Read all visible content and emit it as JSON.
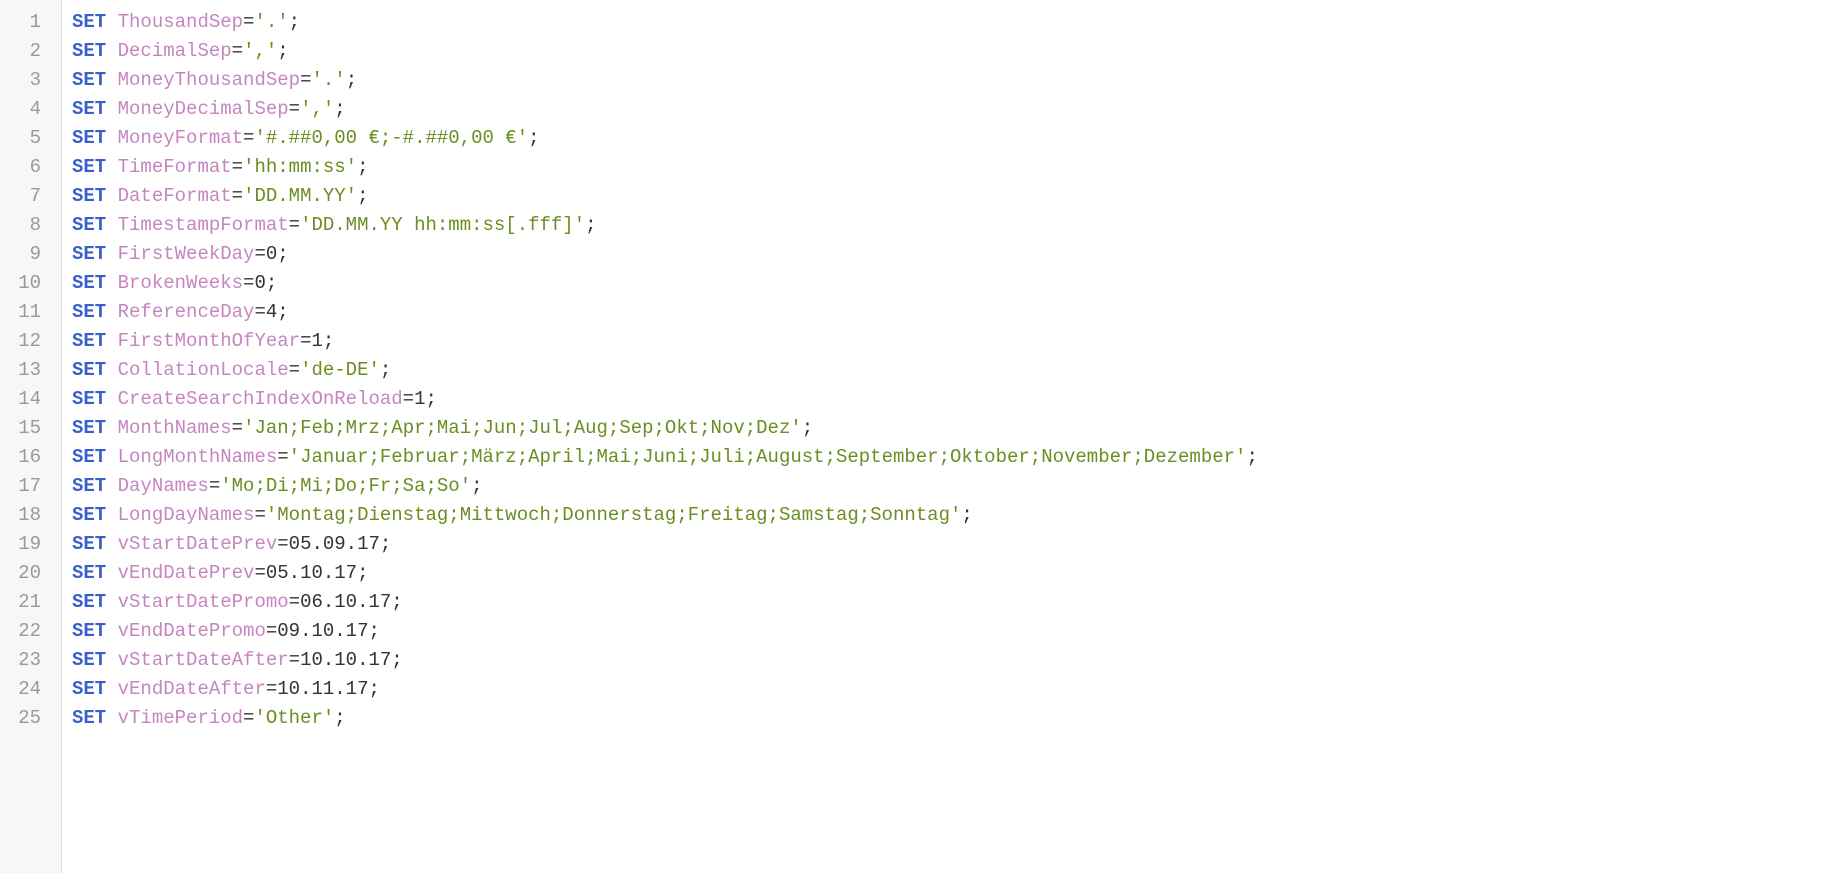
{
  "lines": [
    {
      "ln": "1",
      "kw": "SET",
      "var": "ThousandSep",
      "value": "'.'",
      "valueType": "str"
    },
    {
      "ln": "2",
      "kw": "SET",
      "var": "DecimalSep",
      "value": "','",
      "valueType": "str"
    },
    {
      "ln": "3",
      "kw": "SET",
      "var": "MoneyThousandSep",
      "value": "'.'",
      "valueType": "str"
    },
    {
      "ln": "4",
      "kw": "SET",
      "var": "MoneyDecimalSep",
      "value": "','",
      "valueType": "str"
    },
    {
      "ln": "5",
      "kw": "SET",
      "var": "MoneyFormat",
      "value": "'#.##0,00 €;-#.##0,00 €'",
      "valueType": "str"
    },
    {
      "ln": "6",
      "kw": "SET",
      "var": "TimeFormat",
      "value": "'hh:mm:ss'",
      "valueType": "str"
    },
    {
      "ln": "7",
      "kw": "SET",
      "var": "DateFormat",
      "value": "'DD.MM.YY'",
      "valueType": "str"
    },
    {
      "ln": "8",
      "kw": "SET",
      "var": "TimestampFormat",
      "value": "'DD.MM.YY hh:mm:ss[.fff]'",
      "valueType": "str"
    },
    {
      "ln": "9",
      "kw": "SET",
      "var": "FirstWeekDay",
      "value": "0",
      "valueType": "num"
    },
    {
      "ln": "10",
      "kw": "SET",
      "var": "BrokenWeeks",
      "value": "0",
      "valueType": "num"
    },
    {
      "ln": "11",
      "kw": "SET",
      "var": "ReferenceDay",
      "value": "4",
      "valueType": "num"
    },
    {
      "ln": "12",
      "kw": "SET",
      "var": "FirstMonthOfYear",
      "value": "1",
      "valueType": "num"
    },
    {
      "ln": "13",
      "kw": "SET",
      "var": "CollationLocale",
      "value": "'de-DE'",
      "valueType": "str"
    },
    {
      "ln": "14",
      "kw": "SET",
      "var": "CreateSearchIndexOnReload",
      "value": "1",
      "valueType": "num"
    },
    {
      "ln": "15",
      "kw": "SET",
      "var": "MonthNames",
      "value": "'Jan;Feb;Mrz;Apr;Mai;Jun;Jul;Aug;Sep;Okt;Nov;Dez'",
      "valueType": "str"
    },
    {
      "ln": "16",
      "kw": "SET",
      "var": "LongMonthNames",
      "value": "'Januar;Februar;März;April;Mai;Juni;Juli;August;September;Oktober;November;Dezember'",
      "valueType": "str"
    },
    {
      "ln": "17",
      "kw": "SET",
      "var": "DayNames",
      "value": "'Mo;Di;Mi;Do;Fr;Sa;So'",
      "valueType": "str"
    },
    {
      "ln": "18",
      "kw": "SET",
      "var": "LongDayNames",
      "value": "'Montag;Dienstag;Mittwoch;Donnerstag;Freitag;Samstag;Sonntag'",
      "valueType": "str"
    },
    {
      "ln": "19",
      "kw": "SET",
      "var": "vStartDatePrev",
      "value": "05.09.17",
      "valueType": "num"
    },
    {
      "ln": "20",
      "kw": "SET",
      "var": "vEndDatePrev",
      "value": "05.10.17",
      "valueType": "num"
    },
    {
      "ln": "21",
      "kw": "SET",
      "var": "vStartDatePromo",
      "value": "06.10.17",
      "valueType": "num"
    },
    {
      "ln": "22",
      "kw": "SET",
      "var": "vEndDatePromo",
      "value": "09.10.17",
      "valueType": "num"
    },
    {
      "ln": "23",
      "kw": "SET",
      "var": "vStartDateAfter",
      "value": "10.10.17",
      "valueType": "num"
    },
    {
      "ln": "24",
      "kw": "SET",
      "var": "vEndDateAfter",
      "value": "10.11.17",
      "valueType": "num"
    },
    {
      "ln": "25",
      "kw": "SET",
      "var": "vTimePeriod",
      "value": "'Other'",
      "valueType": "str"
    }
  ],
  "eq": "=",
  "semi": ";"
}
